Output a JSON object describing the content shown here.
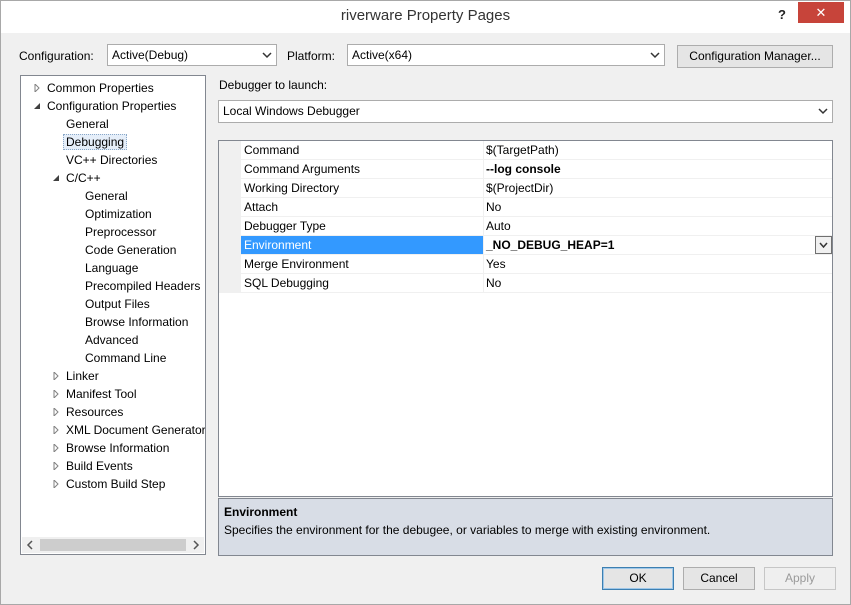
{
  "window": {
    "title": "riverware Property Pages",
    "help_label": "?",
    "close_label": "✕"
  },
  "config_bar": {
    "configuration_label": "Configuration:",
    "configuration_value": "Active(Debug)",
    "platform_label": "Platform:",
    "platform_value": "Active(x64)",
    "manager_button": "Configuration Manager..."
  },
  "tree": {
    "items": [
      {
        "label": "Common Properties",
        "level": 0,
        "expander": "collapsed"
      },
      {
        "label": "Configuration Properties",
        "level": 0,
        "expander": "expanded"
      },
      {
        "label": "General",
        "level": 1,
        "expander": "none"
      },
      {
        "label": "Debugging",
        "level": 1,
        "expander": "none",
        "selected": true
      },
      {
        "label": "VC++ Directories",
        "level": 1,
        "expander": "none"
      },
      {
        "label": "C/C++",
        "level": 1,
        "expander": "expanded"
      },
      {
        "label": "General",
        "level": 2,
        "expander": "none"
      },
      {
        "label": "Optimization",
        "level": 2,
        "expander": "none"
      },
      {
        "label": "Preprocessor",
        "level": 2,
        "expander": "none"
      },
      {
        "label": "Code Generation",
        "level": 2,
        "expander": "none"
      },
      {
        "label": "Language",
        "level": 2,
        "expander": "none"
      },
      {
        "label": "Precompiled Headers",
        "level": 2,
        "expander": "none"
      },
      {
        "label": "Output Files",
        "level": 2,
        "expander": "none"
      },
      {
        "label": "Browse Information",
        "level": 2,
        "expander": "none"
      },
      {
        "label": "Advanced",
        "level": 2,
        "expander": "none"
      },
      {
        "label": "Command Line",
        "level": 2,
        "expander": "none"
      },
      {
        "label": "Linker",
        "level": 1,
        "expander": "collapsed"
      },
      {
        "label": "Manifest Tool",
        "level": 1,
        "expander": "collapsed"
      },
      {
        "label": "Resources",
        "level": 1,
        "expander": "collapsed"
      },
      {
        "label": "XML Document Generator",
        "level": 1,
        "expander": "collapsed"
      },
      {
        "label": "Browse Information",
        "level": 1,
        "expander": "collapsed"
      },
      {
        "label": "Build Events",
        "level": 1,
        "expander": "collapsed"
      },
      {
        "label": "Custom Build Step",
        "level": 1,
        "expander": "collapsed"
      }
    ]
  },
  "debugger": {
    "launch_label": "Debugger to launch:",
    "launch_value": "Local Windows Debugger"
  },
  "properties": [
    {
      "name": "Command",
      "value": "$(TargetPath)",
      "bold": false
    },
    {
      "name": "Command Arguments",
      "value": "--log console",
      "bold": true
    },
    {
      "name": "Working Directory",
      "value": "$(ProjectDir)",
      "bold": false
    },
    {
      "name": "Attach",
      "value": "No",
      "bold": false
    },
    {
      "name": "Debugger Type",
      "value": "Auto",
      "bold": false
    },
    {
      "name": "Environment",
      "value": "_NO_DEBUG_HEAP=1",
      "bold": true,
      "selected": true
    },
    {
      "name": "Merge Environment",
      "value": "Yes",
      "bold": false
    },
    {
      "name": "SQL Debugging",
      "value": "No",
      "bold": false
    }
  ],
  "description": {
    "title": "Environment",
    "text": "Specifies the environment for the debugee, or variables to merge with existing environment."
  },
  "buttons": {
    "ok": "OK",
    "cancel": "Cancel",
    "apply": "Apply"
  },
  "colors": {
    "selection": "#3399ff",
    "close": "#c7443a"
  }
}
